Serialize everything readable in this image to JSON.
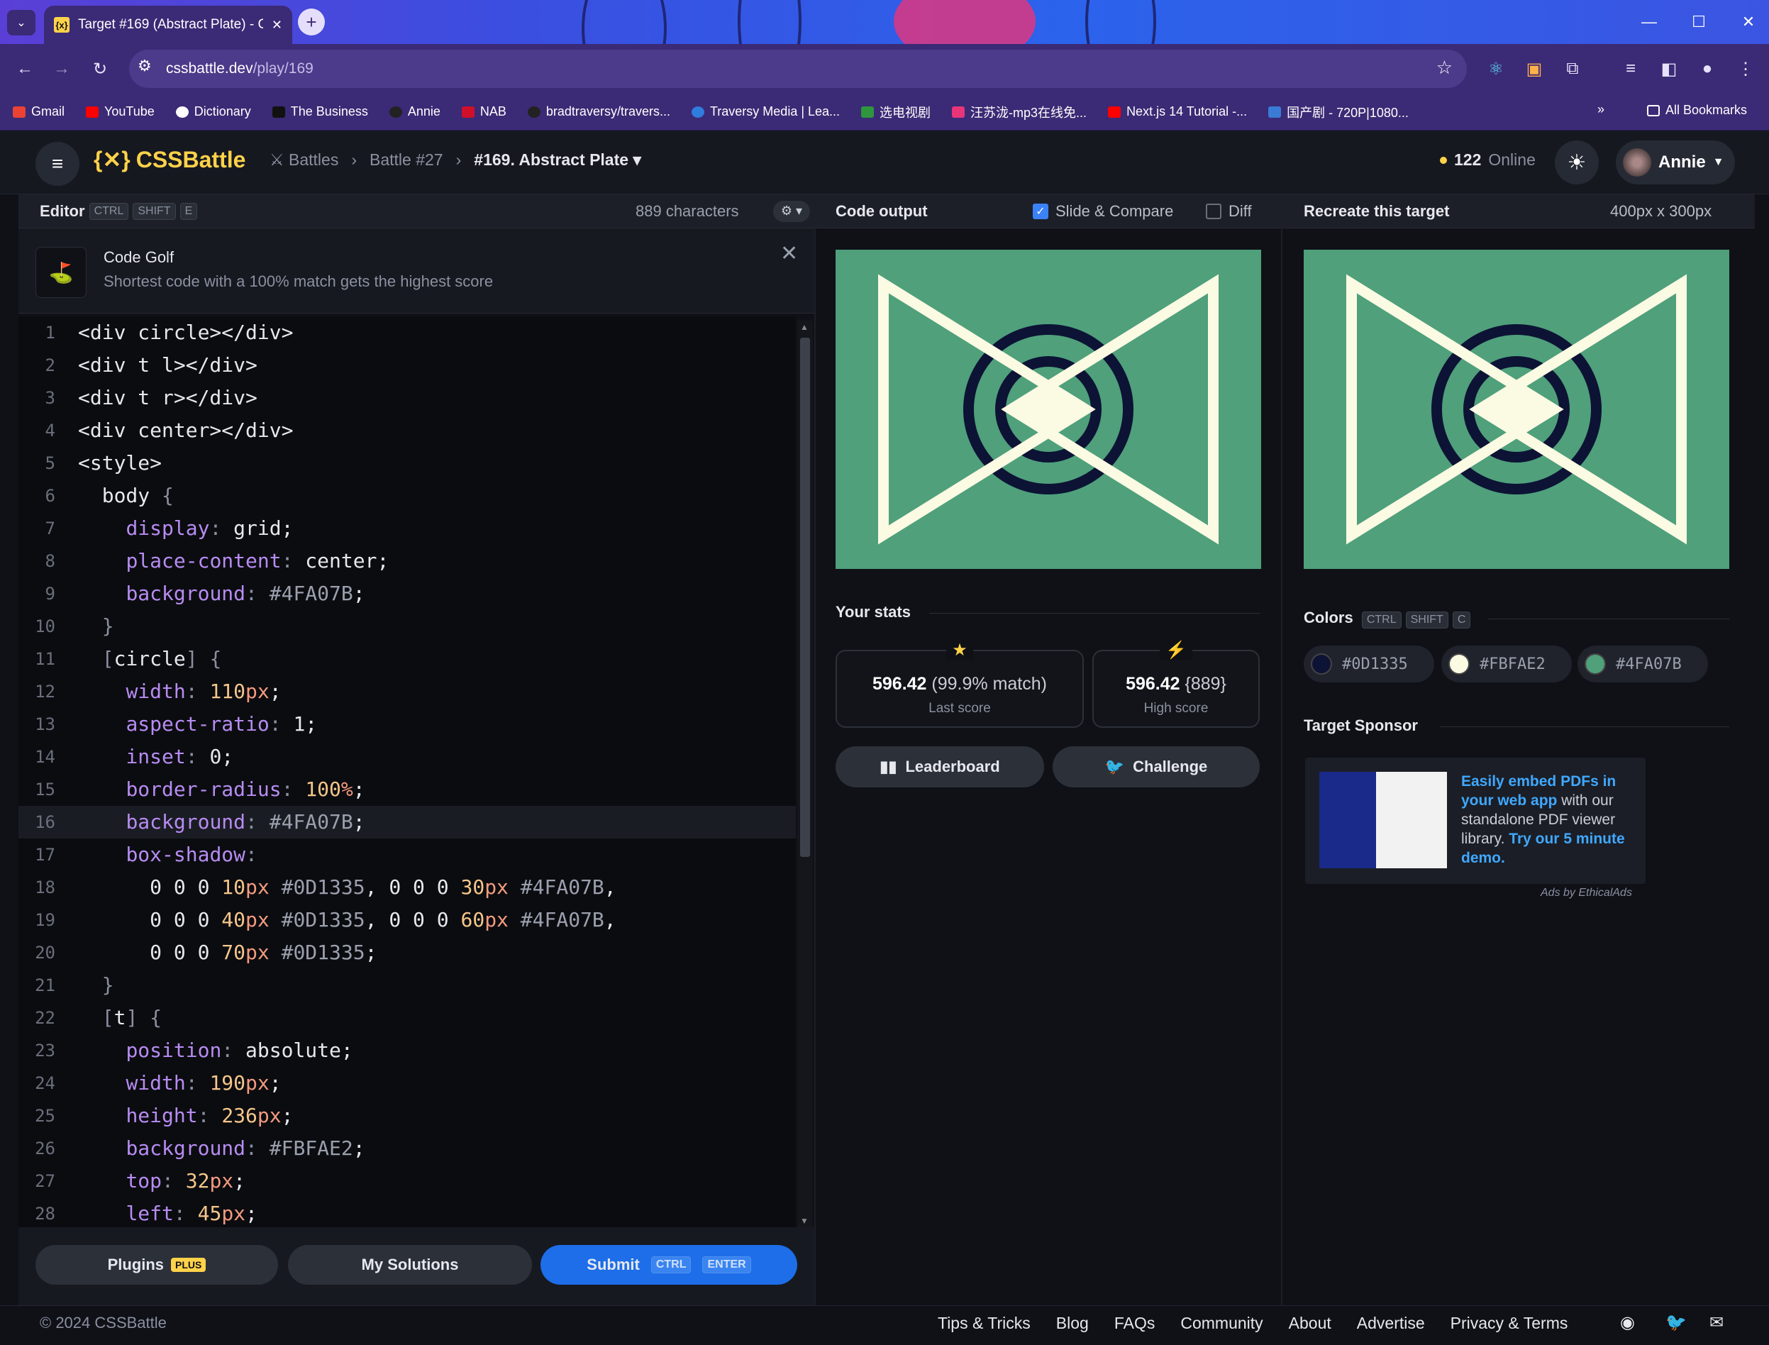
{
  "browser": {
    "tab_title": "Target #169 (Abstract Plate) - C",
    "url_host": "cssbattle.dev",
    "url_path": "/play/169",
    "bookmarks": [
      "Gmail",
      "YouTube",
      "Dictionary",
      "The Business",
      "Annie",
      "NAB",
      "bradtraversy/travers...",
      "Traversy Media | Lea...",
      "选电视剧",
      "汪苏泷-mp3在线免...",
      "Next.js 14 Tutorial -...",
      "国产剧 - 720P|1080..."
    ],
    "all_bookmarks": "All Bookmarks"
  },
  "header": {
    "logo": "CSSBattle",
    "crumb_battles": "Battles",
    "crumb_battle": "Battle #27",
    "crumb_target": "#169. Abstract Plate",
    "online_count": "122",
    "online_label": "Online",
    "user": "Annie"
  },
  "editor": {
    "title": "Editor",
    "keys": [
      "CTRL",
      "SHIFT",
      "E"
    ],
    "characters": "889 characters",
    "golf_title": "Code Golf",
    "golf_sub": "Shortest code with a 100% match gets the highest score",
    "lines": [
      "<div circle></div>",
      "<div t l></div>",
      "<div t r></div>",
      "<div center></div>",
      "<style>",
      "  body {",
      "    display: grid;",
      "    place-content: center;",
      "    background: #4FA07B;",
      "  }",
      "  [circle] {",
      "    width: 110px;",
      "    aspect-ratio: 1;",
      "    inset: 0;",
      "    border-radius: 100%;",
      "    background: #4FA07B;",
      "    box-shadow:",
      "      0 0 0 10px #0D1335, 0 0 0 30px #4FA07B,",
      "      0 0 0 40px #0D1335, 0 0 0 60px #4FA07B,",
      "      0 0 0 70px #0D1335;",
      "  }",
      "  [t] {",
      "    position: absolute;",
      "    width: 190px;",
      "    height: 236px;",
      "    background: #FBFAE2;",
      "    top: 32px;",
      "    left: 45px;"
    ],
    "highlight_line": 16,
    "plugins": "Plugins",
    "plugins_badge": "PLUS",
    "my_solutions": "My Solutions",
    "submit": "Submit",
    "submit_keys": [
      "CTRL",
      "ENTER"
    ]
  },
  "output": {
    "title": "Code output",
    "slide_compare": "Slide & Compare",
    "slide_compare_checked": true,
    "diff": "Diff",
    "diff_checked": false,
    "stats_title": "Your stats",
    "last_score": "596.42",
    "last_match": "(99.9% match)",
    "last_label": "Last score",
    "high_score": "596.42",
    "high_chars": "{889}",
    "high_label": "High score",
    "leaderboard": "Leaderboard",
    "challenge": "Challenge"
  },
  "target": {
    "title": "Recreate this target",
    "dimensions": "400px x 300px",
    "colors_title": "Colors",
    "color_keys": [
      "CTRL",
      "SHIFT",
      "C"
    ],
    "colors": [
      "#0D1335",
      "#FBFAE2",
      "#4FA07B"
    ],
    "sponsor_title": "Target Sponsor",
    "ad_link1": "Easily embed PDFs in your web app",
    "ad_text1": "with our standalone PDF viewer library.",
    "ad_link2": "Try our 5 minute demo.",
    "ad_by": "Ads by EthicalAds"
  },
  "footer": {
    "copyright": "© 2024 CSSBattle",
    "links": [
      "Tips & Tricks",
      "Blog",
      "FAQs",
      "Community",
      "About",
      "Advertise",
      "Privacy & Terms"
    ]
  },
  "palette": {
    "dark": "#0D1335",
    "cream": "#FBFAE2",
    "green": "#4FA07B",
    "accent": "#ffd24a",
    "primary": "#1d6ee8"
  }
}
